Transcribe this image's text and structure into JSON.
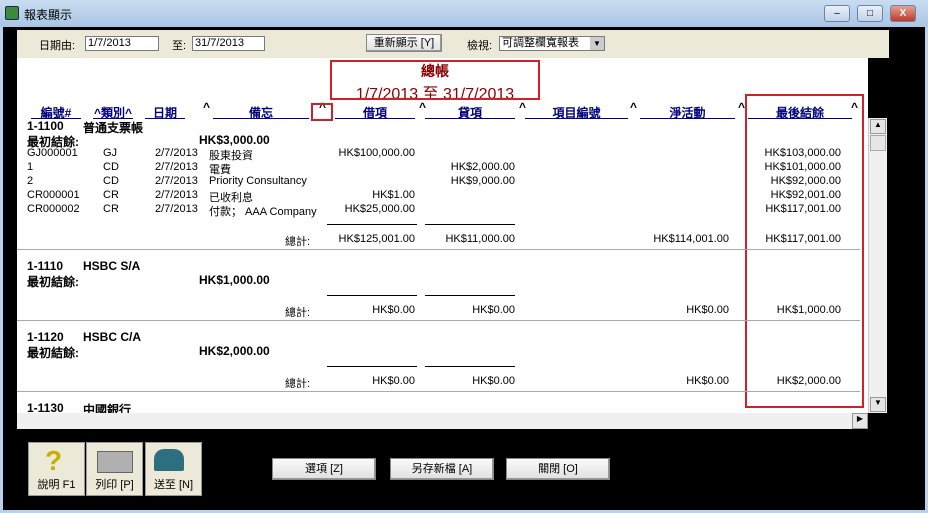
{
  "window": {
    "title": "報表顯示",
    "minimize": "–",
    "maximize": "□",
    "close": "X"
  },
  "filter": {
    "date_from_label": "日期由:",
    "date_from": "1/7/2013",
    "date_to_label": "至:",
    "date_to": "31/7/2013",
    "refresh_button": "重新顯示 [Y]",
    "view_label": "檢視:",
    "view_value": "可調整欄寬報表"
  },
  "report": {
    "title": "總帳",
    "period": "1/7/2013 至 31/7/2013",
    "columns": [
      "編號#",
      "^類別^",
      "日期",
      "備忘",
      "借項",
      "貸項",
      "項目編號",
      "淨活動",
      "最後結餘"
    ],
    "sort_caret": "^",
    "opening_label": "最初結餘:",
    "total_label": "總計:",
    "sections": [
      {
        "account": "1-1100",
        "name": "普通支票帳",
        "opening": "HK$3,000.00",
        "rows": [
          {
            "ref": "GJ000001",
            "type": "GJ",
            "date": "2/7/2013",
            "memo": "股東投資",
            "debit": "HK$100,000.00",
            "credit": "",
            "balance": "HK$103,000.00"
          },
          {
            "ref": "1",
            "type": "CD",
            "date": "2/7/2013",
            "memo": "電費",
            "debit": "",
            "credit": "HK$2,000.00",
            "balance": "HK$101,000.00"
          },
          {
            "ref": "2",
            "type": "CD",
            "date": "2/7/2013",
            "memo": "Priority Consultancy",
            "debit": "",
            "credit": "HK$9,000.00",
            "balance": "HK$92,000.00"
          },
          {
            "ref": "CR000001",
            "type": "CR",
            "date": "2/7/2013",
            "memo": "已收利息",
            "debit": "HK$1.00",
            "credit": "",
            "balance": "HK$92,001.00"
          },
          {
            "ref": "CR000002",
            "type": "CR",
            "date": "2/7/2013",
            "memo": "付款； AAA Company",
            "debit": "HK$25,000.00",
            "credit": "",
            "balance": "HK$117,001.00"
          }
        ],
        "total": {
          "debit": "HK$125,001.00",
          "credit": "HK$11,000.00",
          "net": "HK$114,001.00",
          "balance": "HK$117,001.00"
        }
      },
      {
        "account": "1-1110",
        "name": "HSBC S/A",
        "opening": "HK$1,000.00",
        "rows": [],
        "total": {
          "debit": "HK$0.00",
          "credit": "HK$0.00",
          "net": "HK$0.00",
          "balance": "HK$1,000.00"
        }
      },
      {
        "account": "1-1120",
        "name": "HSBC C/A",
        "opening": "HK$2,000.00",
        "rows": [],
        "total": {
          "debit": "HK$0.00",
          "credit": "HK$0.00",
          "net": "HK$0.00",
          "balance": "HK$2,000.00"
        }
      },
      {
        "account": "1-1130",
        "name": "中國銀行"
      }
    ]
  },
  "toolbar": {
    "help": "說明 F1",
    "print": "列印 [P]",
    "send": "送至 [N]",
    "options": "選項 [Z]",
    "save_as": "另存新檔 [A]",
    "close": "關閉 [O]"
  },
  "colors": {
    "title_text": "#8b0000",
    "header_text": "#000080",
    "highlight": "#d0202a"
  }
}
